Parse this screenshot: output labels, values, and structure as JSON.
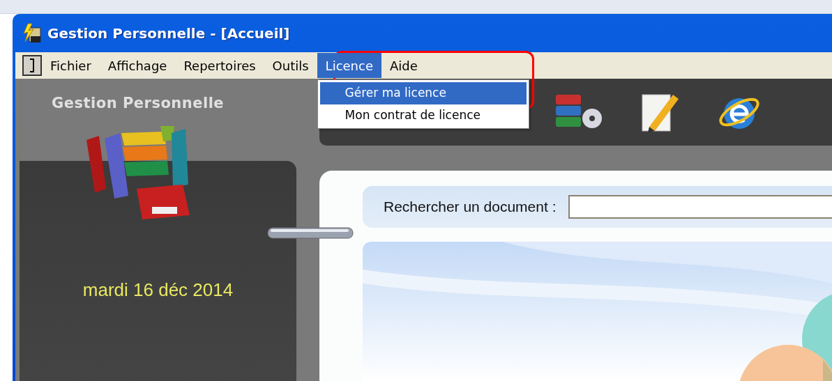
{
  "window": {
    "title": "Gestion Personnelle - [Accueil]"
  },
  "menu": [
    {
      "label": "Fichier",
      "selected": false
    },
    {
      "label": "Affichage",
      "selected": false
    },
    {
      "label": "Repertoires",
      "selected": false
    },
    {
      "label": "Outils",
      "selected": false
    },
    {
      "label": "Licence",
      "selected": true
    },
    {
      "label": "Aide",
      "selected": false
    }
  ],
  "dropdown": [
    {
      "label": "Gérer ma licence",
      "selected": true
    },
    {
      "label": "Mon contrat de licence",
      "selected": false
    }
  ],
  "sidebar": {
    "title": "Gestion Personnelle",
    "date": "mardi 16 déc 2014"
  },
  "search": {
    "label": "Rechercher un document :"
  }
}
